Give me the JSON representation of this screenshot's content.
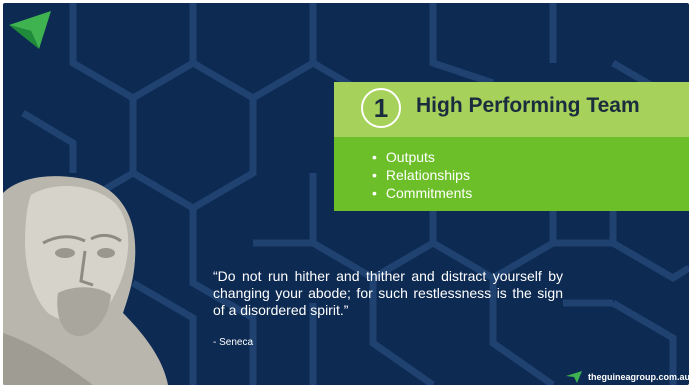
{
  "card": {
    "number": "1",
    "title": "High Performing Team",
    "items": [
      "Outputs",
      "Relationships",
      "Commitments"
    ]
  },
  "quote": {
    "text": "“Do not run hither and thither and distract yourself by changing your abode; for such restlessness is the sign of a disordered spirit.”",
    "author": "- Seneca"
  },
  "footer": {
    "website": "theguineagroup.com.au"
  },
  "colors": {
    "background": "#0d2a52",
    "card_header": "#a6d15b",
    "card_body": "#6cbf29",
    "title_text": "#1a2c3e"
  },
  "icons": {
    "logo": "green-arrow-logo-icon",
    "footer_logo": "green-arrow-small-icon"
  }
}
